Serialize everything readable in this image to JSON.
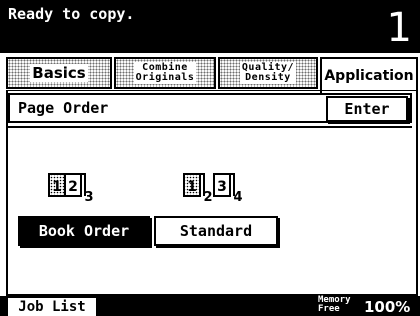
{
  "status": {
    "message": "Ready to copy.",
    "copy_count": "1"
  },
  "tabs": [
    {
      "label": "Basics"
    },
    {
      "label": "Combine\nOriginals"
    },
    {
      "label": "Quality/\nDensity"
    },
    {
      "label": "Application"
    }
  ],
  "panel": {
    "title": "Page Order",
    "enter_label": "Enter"
  },
  "options": {
    "book_order": {
      "label": "Book Order",
      "icon": "book-order-icon",
      "pages": [
        "1",
        "2",
        "3"
      ]
    },
    "standard": {
      "label": "Standard",
      "icon": "standard-order-icon",
      "pages": [
        "1",
        "2",
        "3",
        "4"
      ]
    },
    "selected": "Book Order"
  },
  "footer": {
    "job_list_label": "Job List",
    "memory_label": "Memory\nFree",
    "memory_value": "100%"
  },
  "colors": {
    "foreground": "#000000",
    "background": "#ffffff"
  }
}
